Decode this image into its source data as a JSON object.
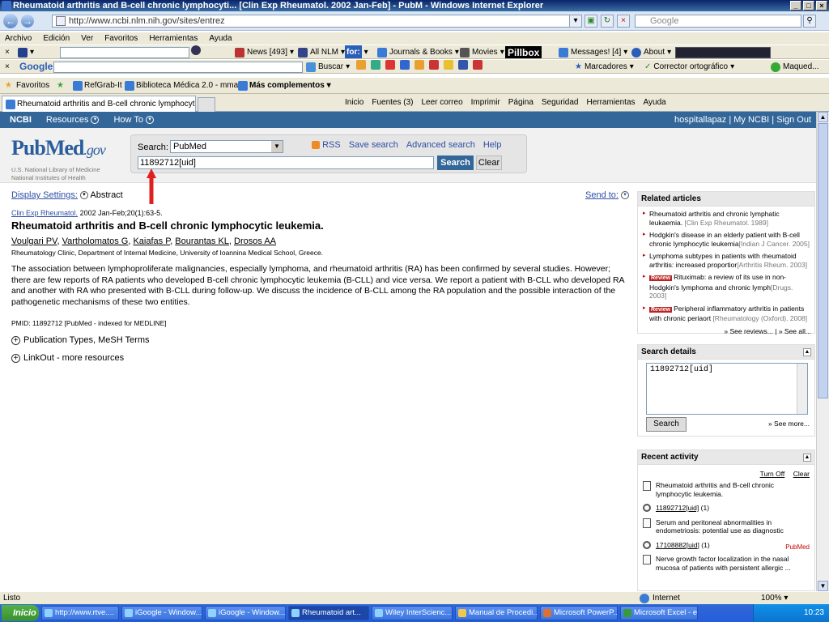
{
  "window": {
    "title": "Rheumatoid arthritis and B-cell chronic lymphocyti... [Clin Exp Rheumatol. 2002 Jan-Feb] - PubM - Windows Internet Explorer",
    "controls": [
      "_",
      "□",
      "×"
    ]
  },
  "address": {
    "url": "http://www.ncbi.nlm.nih.gov/sites/entrez",
    "search_placeholder": "Google"
  },
  "menu": [
    "Archivo",
    "Edición",
    "Ver",
    "Favoritos",
    "Herramientas",
    "Ayuda"
  ],
  "toolbar1": {
    "news": "News [493]",
    "allnlm": "All NLM",
    "journals": "Journals & Books",
    "movies": "Movies",
    "pillbox": "Pillbox",
    "messages": "Messages! [4]",
    "about": "About"
  },
  "toolbar2": {
    "google": "Google",
    "buscar": "Buscar",
    "marcadores": "Marcadores",
    "corrector": "Corrector ortográfico",
    "maqued": "Maqued..."
  },
  "favorites": {
    "label": "Favoritos",
    "items": [
      "RefGrab-It",
      "Biblioteca Médica 2.0 - mma...",
      "Más complementos"
    ]
  },
  "tab": {
    "title": "Rheumatoid arthritis and B-cell chronic lymphocyti... [...",
    "commands": [
      "Inicio",
      "Fuentes (3)",
      "Leer correo",
      "Imprimir",
      "Página",
      "Seguridad",
      "Herramientas",
      "Ayuda"
    ]
  },
  "ncbi": {
    "brand": "NCBI",
    "resources": "Resources",
    "howto": "How To",
    "user": "hospitallapaz | My NCBI | Sign Out"
  },
  "pubmed": {
    "logo_pub": "Pub",
    "logo_med": "Med",
    "logo_gov": ".gov",
    "logo_sub1": "U.S. National Library of Medicine",
    "logo_sub2": "National Institutes of Health",
    "search_label": "Search:",
    "db": "PubMed",
    "term": "11892712[uid]",
    "search_btn": "Search",
    "clear_btn": "Clear",
    "rss": "RSS",
    "save_search": "Save search",
    "advanced": "Advanced search",
    "help": "Help"
  },
  "article": {
    "display_settings": "Display Settings:",
    "display_format": "Abstract",
    "send_to": "Send to:",
    "journal": "Clin Exp Rheumatol.",
    "citation": "2002 Jan-Feb;20(1):63-5.",
    "title": "Rheumatoid arthritis and B-cell chronic lymphocytic leukemia.",
    "authors": [
      "Voulgari PV",
      "Vartholomatos G",
      "Kaiafas P",
      "Bourantas KL",
      "Drosos AA"
    ],
    "affiliation": "Rheumatology Clinic, Department of Internal Medicine, University of Ioannina Medical School, Greece.",
    "abstract": "The association between lymphoproliferate malignancies, especially lymphoma, and rheumatoid arthritis (RA) has been confirmed by several studies. However; there are few reports of RA patients who developed B-cell chronic lymphocytic leukemia (B-CLL) and vice versa. We report a patient with B-CLL who developed RA and another with RA who presented with B-CLL during follow-up. We discuss the incidence of B-CLL among the RA population and the possible interaction of the pathogenetic mechanisms of these two entities.",
    "pmid": "PMID: 11892712 [PubMed - indexed for MEDLINE]",
    "pub_types": "Publication Types, MeSH Terms",
    "linkout": "LinkOut - more resources"
  },
  "related": {
    "header": "Related articles",
    "items": [
      {
        "title": "Rheumatoid arthritis and chronic lymphatic leukaemia.",
        "src": "[Clin Exp Rheumatol. 1989]",
        "review": false
      },
      {
        "title": "Hodgkin's disease in an elderly patient with B-cell chronic lymphocytic leukemia",
        "src": "[Indian J Cancer. 2005]",
        "review": false
      },
      {
        "title": "Lymphoma subtypes in patients with rheumatoid arthritis: increased proportior",
        "src": "[Arthritis Rheum. 2003]",
        "review": false
      },
      {
        "title": "Rituximab: a review of its use in non-Hodgkin's lymphoma and chronic lymph",
        "src": "[Drugs. 2003]",
        "review": true
      },
      {
        "title": "Peripheral inflammatory arthritis in patients with chronic periaort",
        "src": "[Rheumatology (Oxford). 2008]",
        "review": true
      }
    ],
    "review_label": "Review",
    "see_reviews": "» See reviews... | » See all..."
  },
  "search_details": {
    "header": "Search details",
    "query": "11892712[uid]",
    "button": "Search",
    "see_more": "» See more..."
  },
  "recent": {
    "header": "Recent activity",
    "turn_off": "Turn Off",
    "clear": "Clear",
    "items": [
      {
        "type": "doc",
        "text": "Rheumatoid arthritis and B-cell chronic lymphocytic leukemia."
      },
      {
        "type": "search",
        "text": "11892712[uid]",
        "count": "(1)"
      },
      {
        "type": "doc",
        "text": "Serum and peritoneal abnormalities in endometriosis: potential use as diagnostic"
      },
      {
        "type": "search",
        "text": "17108882[uid]",
        "count": "(1)",
        "tag": "PubMed"
      },
      {
        "type": "doc",
        "text": "Nerve growth factor localization in the nasal mucosa of patients with persistent allergic ..."
      }
    ]
  },
  "status": {
    "left": "Listo",
    "zone": "Internet",
    "zoom": "100%"
  },
  "taskbar": {
    "start": "Inicio",
    "items": [
      "http://www.rtve....",
      "iGoogle - Window...",
      "iGoogle - Window...",
      "Rheumatoid art...",
      "Wiley InterScienc...",
      "Manual de Procedi...",
      "Microsoft PowerP...",
      "Microsoft Excel - e..."
    ],
    "active_index": 3,
    "clock": "10:23"
  },
  "colors": {
    "ncbi_blue": "#336699",
    "link": "#2e4fa5",
    "annotation_arrow": "#e02020"
  }
}
